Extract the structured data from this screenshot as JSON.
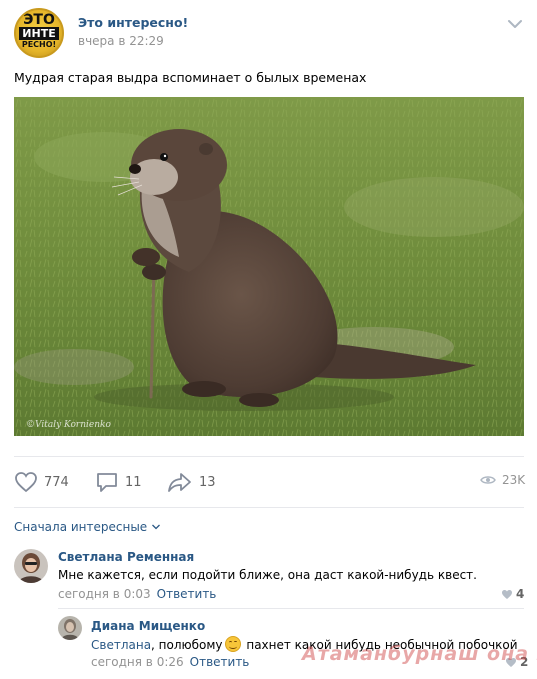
{
  "post": {
    "group_name": "Это интересно!",
    "time": "вчера в 22:29",
    "text": "Мудрая старая выдра вспоминает о былых временах",
    "logo_lines": [
      "ЭТО",
      "ИНТЕ",
      "РЕСНО!"
    ],
    "photo_watermark": "©Vitaly Kornienko",
    "photo_subject": "otter-with-walking-stick"
  },
  "actions": {
    "likes": "774",
    "comments": "11",
    "shares": "13",
    "views": "23K"
  },
  "sort_label": "Сначала интересные",
  "comments": [
    {
      "author": "Светлана Ременная",
      "text": "Мне кажется, если подойти ближе, она даст какой-нибудь квест.",
      "time": "сегодня в 0:03",
      "reply_label": "Ответить",
      "likes": "4"
    },
    {
      "author": "Диана Мищенко",
      "mention": "Светлана",
      "text_before_emoji": ", полюбому",
      "text_after_emoji": " пахнет какой нибудь необычной побочкой",
      "time": "сегодня в 0:26",
      "reply_label": "Ответить",
      "likes": "2"
    }
  ],
  "site_watermark": "Атаманбурнаш она ли",
  "colors": {
    "link": "#2a5885",
    "muted": "#939393",
    "divider": "#e7e8ec",
    "logo_gold": "#e5b52a"
  }
}
